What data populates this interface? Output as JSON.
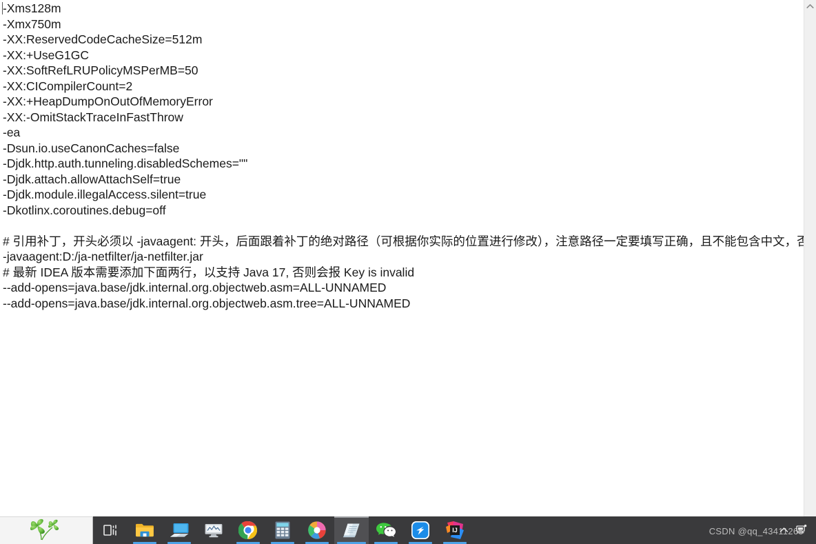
{
  "editor": {
    "name": "text-editor",
    "lines": [
      "-Xms128m",
      "-Xmx750m",
      "-XX:ReservedCodeCacheSize=512m",
      "-XX:+UseG1GC",
      "-XX:SoftRefLRUPolicyMSPerMB=50",
      "-XX:CICompilerCount=2",
      "-XX:+HeapDumpOnOutOfMemoryError",
      "-XX:-OmitStackTraceInFastThrow",
      "-ea",
      "-Dsun.io.useCanonCaches=false",
      "-Djdk.http.auth.tunneling.disabledSchemes=\"\"",
      "-Djdk.attach.allowAttachSelf=true",
      "-Djdk.module.illegalAccess.silent=true",
      "-Dkotlinx.coroutines.debug=off",
      "",
      "# 引用补丁，开头必须以 -javaagent: 开头，后面跟着补丁的绝对路径（可根据你实际的位置进行修改），注意路径一定要填写正确，且不能包含中文，否则会导",
      "-javaagent:D:/ja-netfilter/ja-netfilter.jar",
      "# 最新 IDEA 版本需要添加下面两行，以支持 Java 17, 否则会报 Key is invalid",
      "--add-opens=java.base/jdk.internal.org.objectweb.asm=ALL-UNNAMED",
      "--add-opens=java.base/jdk.internal.org.objectweb.asm.tree=ALL-UNNAMED"
    ],
    "text_color": "#1a1a1a",
    "background": "#ffffff"
  },
  "scrollbar": {
    "up_arrow_icon": "chevron-up-icon",
    "track_color": "#f0f0f0"
  },
  "taskbar": {
    "background": "#3a3a3c",
    "accent": "#4da3e8",
    "start_panel": {
      "icon": "clover-icon",
      "background": "#f4f4f4"
    },
    "items": [
      {
        "label": "Task View",
        "icon": "task-view-icon",
        "active": false,
        "running": false
      },
      {
        "label": "File Explorer",
        "icon": "folder-icon",
        "active": false,
        "running": true
      },
      {
        "label": "Remote Desktop",
        "icon": "remote-desktop-icon",
        "active": false,
        "running": true
      },
      {
        "label": "System Monitor",
        "icon": "monitor-chart-icon",
        "active": false,
        "running": false
      },
      {
        "label": "Google Chrome",
        "icon": "chrome-icon",
        "active": false,
        "running": true
      },
      {
        "label": "Calculator",
        "icon": "calculator-icon",
        "active": false,
        "running": true
      },
      {
        "label": "360 Browser",
        "icon": "color-swirl-icon",
        "active": false,
        "running": true
      },
      {
        "label": "Notepad",
        "icon": "notepad-icon",
        "active": true,
        "running": true
      },
      {
        "label": "WeChat",
        "icon": "wechat-icon",
        "active": false,
        "running": true
      },
      {
        "label": "DingTalk",
        "icon": "dingtalk-icon",
        "active": false,
        "running": true
      },
      {
        "label": "IntelliJ IDEA",
        "icon": "intellij-idea-icon",
        "active": false,
        "running": true
      }
    ]
  },
  "tray": {
    "items": [
      {
        "label": "Show hidden icons",
        "icon": "chevron-up-icon"
      },
      {
        "label": "Network",
        "icon": "network-icon"
      }
    ]
  },
  "watermark": {
    "text": "CSDN @qq_43411265"
  }
}
